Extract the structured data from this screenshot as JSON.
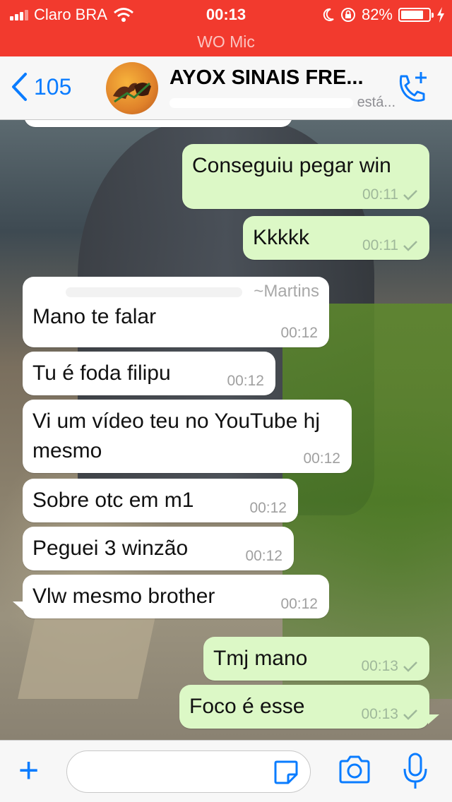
{
  "status_bar": {
    "carrier": "Claro BRA",
    "time": "00:13",
    "battery": "82%",
    "battery_level": 0.82
  },
  "mic_banner": "WO Mic",
  "header": {
    "back_count": "105",
    "title": "AYOX SINAIS FRE...",
    "subtitle": "está..."
  },
  "messages": [
    {
      "dir": "out",
      "text": "Conseguiu pegar win",
      "time": "00:11",
      "read": true
    },
    {
      "dir": "out",
      "text": "Kkkkk",
      "time": "00:11",
      "read": true
    },
    {
      "dir": "in",
      "sender": "~Martins",
      "text": "Mano te falar",
      "time": "00:12"
    },
    {
      "dir": "in",
      "text": "Tu é foda filipu",
      "time": "00:12"
    },
    {
      "dir": "in",
      "text": "Vi um vídeo teu no YouTube hj mesmo",
      "time": "00:12"
    },
    {
      "dir": "in",
      "text": "Sobre otc em m1",
      "time": "00:12"
    },
    {
      "dir": "in",
      "text": "Peguei 3 winzão",
      "time": "00:12"
    },
    {
      "dir": "in",
      "text": "Vlw mesmo brother",
      "time": "00:12"
    },
    {
      "dir": "out",
      "text": "Tmj mano",
      "time": "00:13",
      "read": true
    },
    {
      "dir": "out",
      "text": "Foco é esse",
      "time": "00:13",
      "read": true
    }
  ],
  "input": {
    "value": "",
    "placeholder": ""
  },
  "icons": {
    "accent": "#0a7cff",
    "status_bar_color": "#f23a2e",
    "outgoing_bubble": "#dcf8c6",
    "incoming_bubble": "#ffffff"
  }
}
